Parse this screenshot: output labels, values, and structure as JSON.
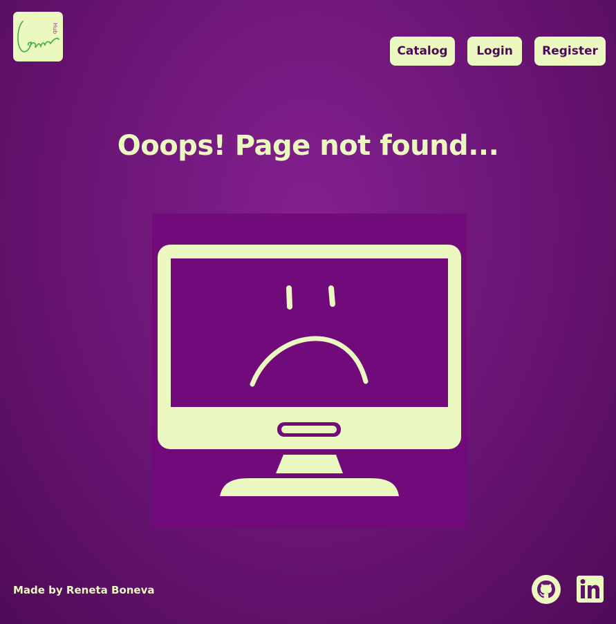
{
  "logo": {
    "icon": "gamehub-logo",
    "wordmark": "Game",
    "superscript": "Hub"
  },
  "nav": {
    "catalog": "Catalog",
    "login": "Login",
    "register": "Register"
  },
  "page": {
    "title": "Ooops! Page not found..."
  },
  "illustration": {
    "icon": "sad-monitor-icon"
  },
  "footer": {
    "credit": "Made by Reneta Boneva",
    "github_icon": "github-icon",
    "linkedin_icon": "linkedin-icon"
  },
  "colors": {
    "background": "#6e1679",
    "accent": "#ebf8bf",
    "dark_text": "#4b0a57",
    "panel": "#710b7c",
    "logo_green": "#3fae3f"
  }
}
